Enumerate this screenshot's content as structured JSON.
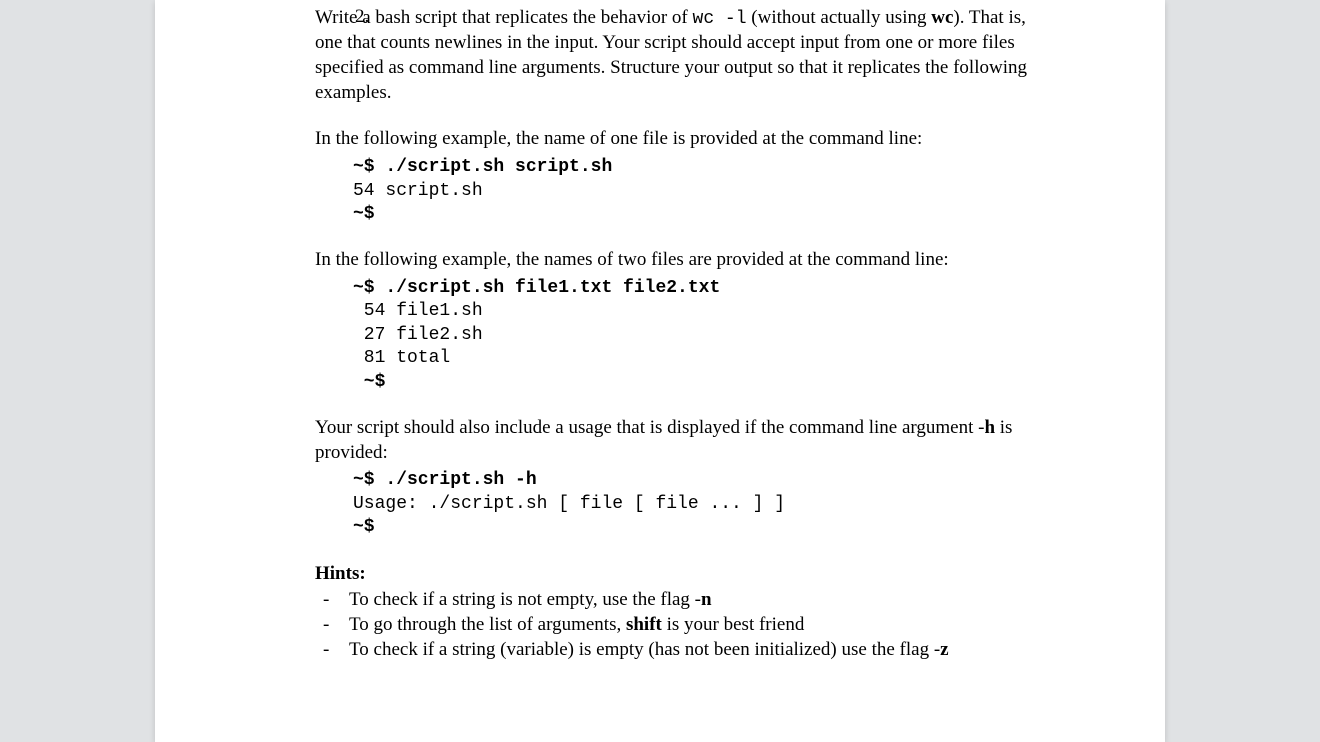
{
  "question": {
    "number": "2.",
    "intro": {
      "part1": "Write a bash script that replicates the behavior of ",
      "code1": "wc -l",
      "part2": " (without actually using ",
      "bold1": "wc",
      "part3": "). That is, one that counts newlines in the input. Your script should accept input from one or more files specified as command line arguments. Structure your output so that it replicates the following examples."
    },
    "example1": {
      "lead": "In the following example, the name of one file is provided at the command line:",
      "line1": "~$ ./script.sh script.sh",
      "line2": "54 script.sh",
      "line3": "~$"
    },
    "example2": {
      "lead": "In the following example, the names of two files are provided at the command line:",
      "line1": "~$ ./script.sh file1.txt file2.txt",
      "line2": " 54 file1.sh",
      "line3": " 27 file2.sh",
      "line4": " 81 total",
      "line5": " ~$"
    },
    "usage": {
      "lead1": "Your script should also include a usage that is displayed if the command line argument -",
      "bold_h": "h",
      "lead2": " is provided:",
      "line1": "~$ ./script.sh -h",
      "line2": "Usage: ./script.sh [ file [ file ... ] ]",
      "line3": "~$"
    },
    "hints": {
      "header": "Hints:",
      "items": [
        {
          "dash": "-",
          "t1": "To check if a string is not empty, use the flag -",
          "b1": "n",
          "t2": ""
        },
        {
          "dash": "-",
          "t1": "To go through the list of arguments, ",
          "b1": "shift",
          "t2": " is your best friend"
        },
        {
          "dash": "-",
          "t1": "To check if a string (variable) is empty (has not been initialized) use the flag -",
          "b1": "z",
          "t2": ""
        }
      ]
    }
  }
}
